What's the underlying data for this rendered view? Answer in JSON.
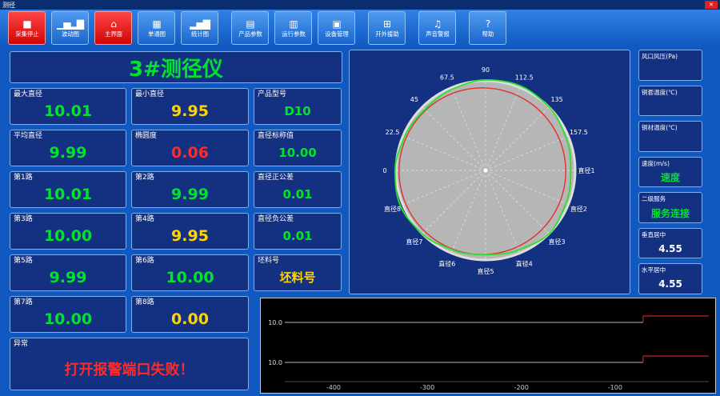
{
  "window": {
    "title": "测径",
    "close_glyph": "✕"
  },
  "toolbar": {
    "buttons": [
      {
        "name": "stop-capture",
        "label": "采集停止",
        "glyph": "■",
        "accent": true
      },
      {
        "name": "wave-chart",
        "label": "波动图",
        "glyph": "▁▅▂▇",
        "accent": false
      },
      {
        "name": "main-screen",
        "label": "主界面",
        "glyph": "⌂",
        "accent": true
      },
      {
        "name": "single-chart",
        "label": "单通图",
        "glyph": "▦",
        "accent": false
      },
      {
        "name": "stats-chart",
        "label": "统计图",
        "glyph": "▂▅▇",
        "accent": false
      },
      {
        "name": "product-params",
        "label": "产品参数",
        "glyph": "▤",
        "accent": false
      },
      {
        "name": "run-params",
        "label": "运行参数",
        "glyph": "▥",
        "accent": false
      },
      {
        "name": "device-manage",
        "label": "设备管理",
        "glyph": "▣",
        "accent": false
      },
      {
        "name": "remote-assist",
        "label": "开外援助",
        "glyph": "⊞",
        "accent": false
      },
      {
        "name": "sound-alarm",
        "label": "声音警报",
        "glyph": "♫",
        "accent": false
      },
      {
        "name": "help",
        "label": "帮助",
        "glyph": "?",
        "accent": false
      }
    ]
  },
  "left": {
    "title": "3#测径仪",
    "boxes": [
      {
        "name": "max-diameter",
        "label": "最大直径",
        "value": "10.01",
        "color": "green",
        "col": 1
      },
      {
        "name": "min-diameter",
        "label": "最小直径",
        "value": "9.95",
        "color": "yellow",
        "col": 2
      },
      {
        "name": "product-model",
        "label": "产品型号",
        "value": "D10",
        "color": "green",
        "col": 3
      },
      {
        "name": "avg-diameter",
        "label": "平均直径",
        "value": "9.99",
        "color": "green",
        "col": 1
      },
      {
        "name": "ovality",
        "label": "椭圆度",
        "value": "0.06",
        "color": "red",
        "col": 2
      },
      {
        "name": "nominal-diameter",
        "label": "直径标称值",
        "value": "10.00",
        "color": "green",
        "col": 3
      },
      {
        "name": "path-1",
        "label": "第1路",
        "value": "10.01",
        "color": "green",
        "col": 1
      },
      {
        "name": "path-2",
        "label": "第2路",
        "value": "9.99",
        "color": "green",
        "col": 2
      },
      {
        "name": "tolerance-plus",
        "label": "直径正公差",
        "value": "0.01",
        "color": "green",
        "col": 3
      },
      {
        "name": "path-3",
        "label": "第3路",
        "value": "10.00",
        "color": "green",
        "col": 1
      },
      {
        "name": "path-4",
        "label": "第4路",
        "value": "9.95",
        "color": "yellow",
        "col": 2
      },
      {
        "name": "tolerance-minus",
        "label": "直径负公差",
        "value": "0.01",
        "color": "green",
        "col": 3
      },
      {
        "name": "path-5",
        "label": "第5路",
        "value": "9.99",
        "color": "green",
        "col": 1
      },
      {
        "name": "path-6",
        "label": "第6路",
        "value": "10.00",
        "color": "green",
        "col": 2
      },
      {
        "name": "billet-no",
        "label": "坯料号",
        "value": "坯料号",
        "color": "yellow",
        "col": 3
      },
      {
        "name": "path-7",
        "label": "第7路",
        "value": "10.00",
        "color": "green",
        "col": 1
      },
      {
        "name": "path-8",
        "label": "第8路",
        "value": "0.00",
        "color": "yellow",
        "col": 2
      }
    ],
    "alarm": {
      "label": "异常",
      "value": "打开报警端口失败！"
    }
  },
  "right": {
    "boxes": [
      {
        "name": "air-pressure",
        "label": "风口风压(Pa)",
        "value": "",
        "color": "white"
      },
      {
        "name": "sleeve-temp",
        "label": "铜套温度(℃)",
        "value": "",
        "color": "white"
      },
      {
        "name": "rod-temp",
        "label": "铜材温度(℃)",
        "value": "",
        "color": "white"
      },
      {
        "name": "speed",
        "label": "速度(m/s)",
        "value": "速度",
        "color": "green"
      },
      {
        "name": "service-link",
        "label": "二级服务",
        "value": "服务连接",
        "color": "green"
      },
      {
        "name": "vertical-center",
        "label": "垂直居中",
        "value": "4.55",
        "color": "white"
      },
      {
        "name": "horizontal-center",
        "label": "水平居中",
        "value": "4.55",
        "color": "white"
      }
    ]
  },
  "polar": {
    "upper_labels": [
      "0",
      "22.5",
      "45",
      "67.5",
      "90",
      "112.5",
      "135",
      "157.5"
    ],
    "lower_labels": [
      "直径1",
      "直径2",
      "直径3",
      "直径4",
      "直径5",
      "直径6",
      "直径7",
      "直径8"
    ],
    "red_radius": 0.93,
    "red_color": "#e03030",
    "green_color": "#2ce02c",
    "disc_color": "#b6b6b6",
    "green_radii": [
      0.95,
      0.97,
      1.0,
      1.02,
      1.01,
      0.98,
      0.96,
      0.98,
      1.01,
      1.03,
      1.0,
      0.96,
      0.94,
      0.96,
      1.0,
      0.97
    ]
  },
  "trend": {
    "y_labels": [
      "10.0",
      "10.0"
    ],
    "x_ticks": [
      "-400",
      "-300",
      "-200",
      "-100"
    ],
    "line_color": "#b9b9b9",
    "alarm_color": "#ff2222"
  }
}
